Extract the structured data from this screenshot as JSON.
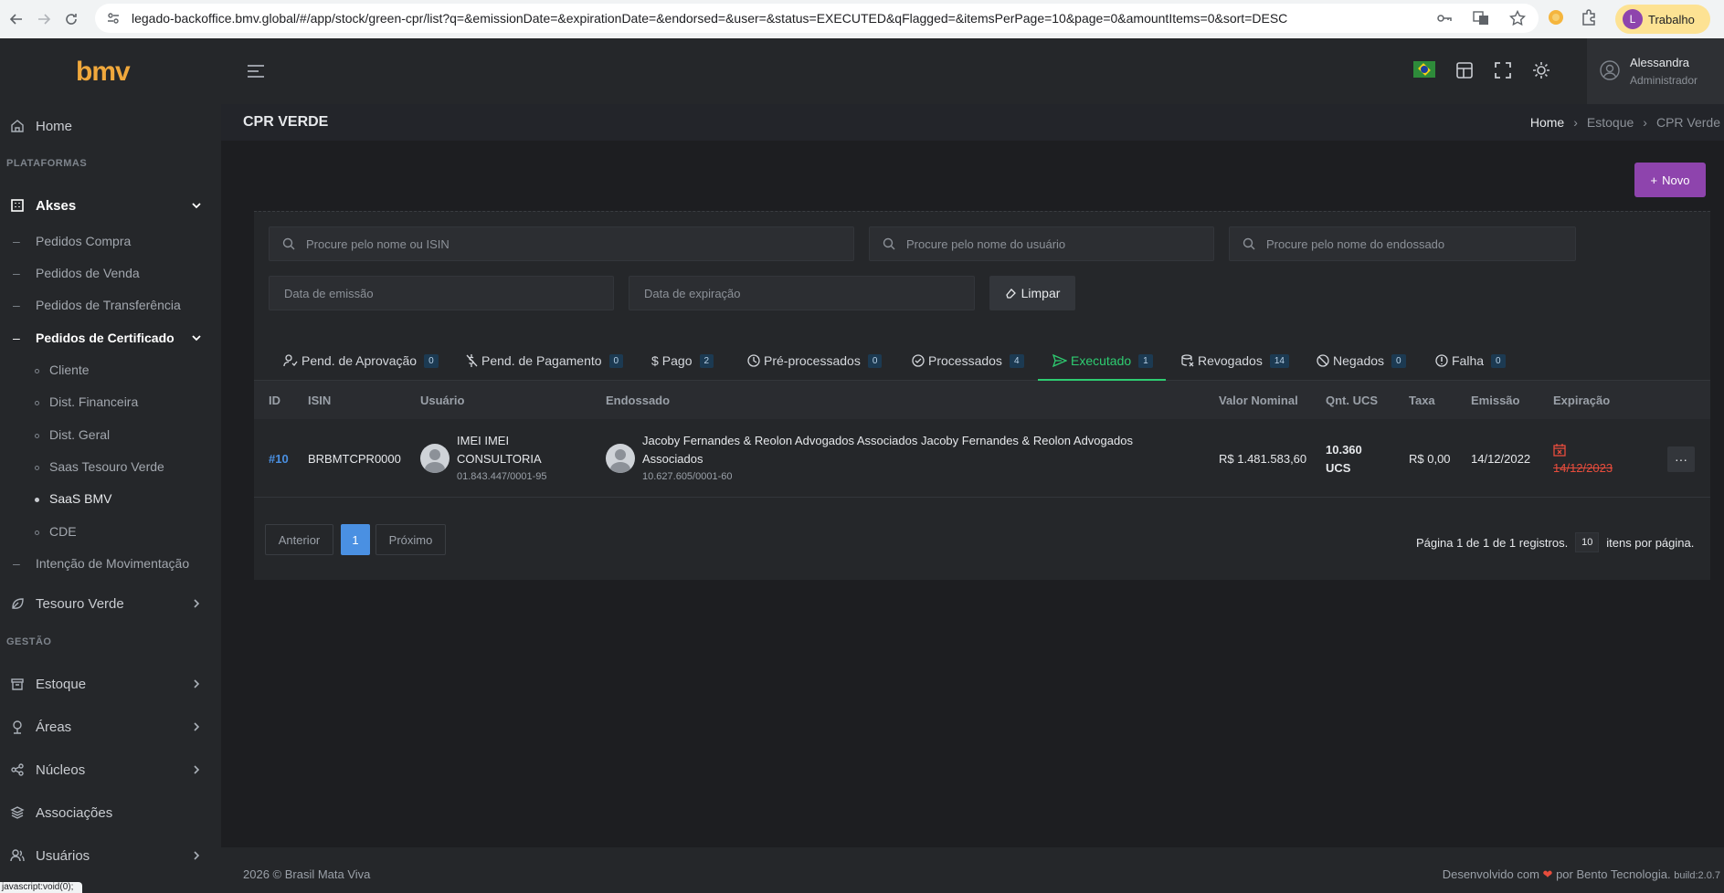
{
  "browser": {
    "url": "legado-backoffice.bmv.global/#/app/stock/green-cpr/list?q=&emissionDate=&expirationDate=&endorsed=&user=&status=EXECUTED&qFlagged=&itemsPerPage=10&page=0&amountItems=0&sort=DESC",
    "profile_initial": "L",
    "profile_label": "Trabalho",
    "status_text": "javascript:void(0);"
  },
  "sidebar": {
    "logo": "bmv",
    "home": "Home",
    "section_plataformas": "PLATAFORMAS",
    "akses": "Akses",
    "akses_items": [
      "Pedidos Compra",
      "Pedidos de Venda",
      "Pedidos de Transferência",
      "Pedidos de Certificado"
    ],
    "certificado_items": [
      "Cliente",
      "Dist. Financeira",
      "Dist. Geral",
      "Saas Tesouro Verde",
      "SaaS BMV",
      "CDE"
    ],
    "intencao": "Intenção de Movimentação",
    "tesouro": "Tesouro Verde",
    "section_gestao": "GESTÃO",
    "estoque": "Estoque",
    "areas": "Áreas",
    "nucleos": "Núcleos",
    "associacoes": "Associações",
    "usuarios": "Usuários"
  },
  "header": {
    "user_name": "Alessandra",
    "user_role": "Administrador"
  },
  "page": {
    "title": "CPR VERDE",
    "breadcrumb": [
      "Home",
      "Estoque",
      "CPR Verde"
    ],
    "novo_label": "Novo"
  },
  "filters": {
    "search_isin": "Procure pelo nome ou ISIN",
    "search_user": "Procure pelo nome do usuário",
    "search_endorsed": "Procure pelo nome do endossado",
    "emission_date": "Data de emissão",
    "expiration_date": "Data de expiração",
    "clear_label": "Limpar"
  },
  "tabs": [
    {
      "label": "Pend. de Aprovação",
      "count": "0"
    },
    {
      "label": "Pend. de Pagamento",
      "count": "0"
    },
    {
      "label": "Pago",
      "count": "2"
    },
    {
      "label": "Pré-processados",
      "count": "0"
    },
    {
      "label": "Processados",
      "count": "4"
    },
    {
      "label": "Executado",
      "count": "1"
    },
    {
      "label": "Revogados",
      "count": "14"
    },
    {
      "label": "Negados",
      "count": "0"
    },
    {
      "label": "Falha",
      "count": "0"
    }
  ],
  "table": {
    "columns": [
      "ID",
      "ISIN",
      "Usuário",
      "Endossado",
      "Valor Nominal",
      "Qnt. UCS",
      "Taxa",
      "Emissão",
      "Expiração"
    ],
    "rows": [
      {
        "id": "#10",
        "isin": "BRBMTCPR0000",
        "user_name_1": "IMEI IMEI",
        "user_name_2": "CONSULTORIA",
        "user_doc": "01.843.447/0001-95",
        "endorsed_name_1": "Jacoby Fernandes & Reolon Advogados Associados Jacoby Fernandes & Reolon Advogados",
        "endorsed_name_2": "Associados",
        "endorsed_doc": "10.627.605/0001-60",
        "valor_nominal": "R$ 1.481.583,60",
        "ucs_1": "10.360",
        "ucs_2": "UCS",
        "taxa": "R$ 0,00",
        "emissao": "14/12/2022",
        "expiracao": "14/12/2023",
        "actions": "···"
      }
    ]
  },
  "pagination": {
    "prev": "Anterior",
    "current": "1",
    "next": "Próximo",
    "info": "Página 1 de 1 de 1 registros.",
    "per_page": "10",
    "per_page_suffix": "itens por página."
  },
  "footer": {
    "left": "2026 © Brasil Mata Viva",
    "right_prefix": "Desenvolvido com",
    "heart": "❤",
    "right_suffix": "por Bento Tecnologia.",
    "build": "build:2.0.7"
  },
  "colors": {
    "accent": "#8e44ad",
    "active_tab": "#2ecc71",
    "link": "#4a90e2",
    "expired": "#e74c3c",
    "logo": "#f0a83c"
  }
}
